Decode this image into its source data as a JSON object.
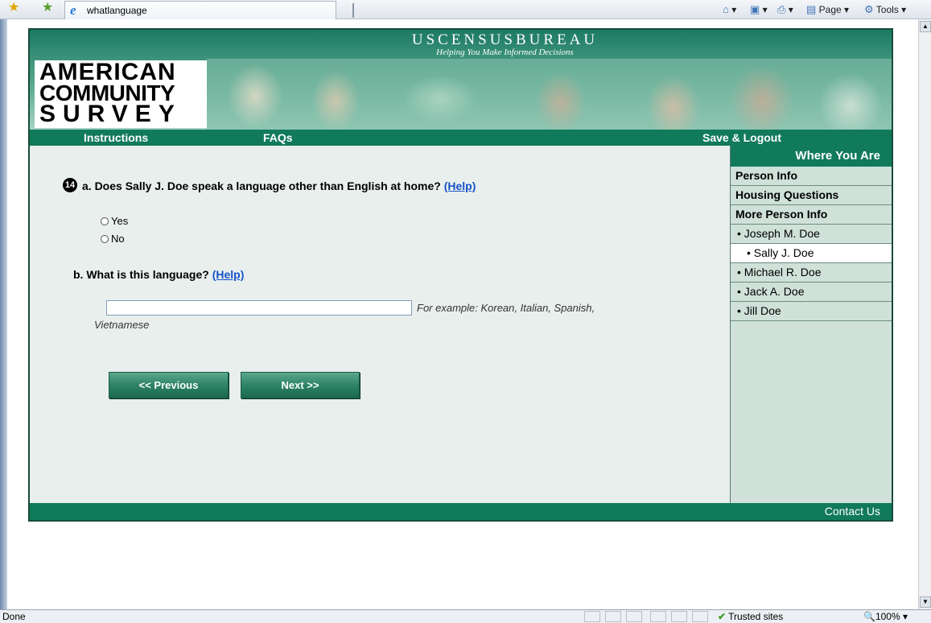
{
  "browser": {
    "tab_title": "whatlanguage",
    "toolbar": {
      "page_label": "Page",
      "tools_label": "Tools"
    },
    "status": {
      "text": "Done",
      "zone": "Trusted sites",
      "zoom": "100%"
    }
  },
  "header": {
    "agency_title": "USCENSUSBUREAU",
    "agency_tagline": "Helping You Make Informed Decisions",
    "logo_lines": [
      "AMERICAN",
      "COMMUNITY",
      "SURVEY"
    ]
  },
  "nav": {
    "instructions": "Instructions",
    "faqs": "FAQs",
    "save_logout": "Save & Logout"
  },
  "question": {
    "number": "14",
    "a_text": "a. Does Sally J. Doe speak a language other than English at home?",
    "b_text": "b. What is this language?",
    "help_label": "(Help)",
    "options": [
      "Yes",
      "No"
    ],
    "language_value": "",
    "hint_line1": "For example: Korean, Italian, Spanish,",
    "hint_line2": "Vietnamese"
  },
  "buttons": {
    "previous": "<<   Previous",
    "next": "Next   >>"
  },
  "sidebar": {
    "title": "Where You Are",
    "sections": [
      "Person Info",
      "Housing Questions",
      "More Person Info"
    ],
    "people": [
      "• Joseph M. Doe",
      "• Sally J. Doe",
      "• Michael R. Doe",
      "• Jack A. Doe",
      "• Jill Doe"
    ],
    "current_person": "• Sally J. Doe"
  },
  "footer": {
    "contact": "Contact Us"
  },
  "colors": {
    "brand_green": "#117a5a",
    "panel_bg": "#e8efed",
    "sidebar_bg": "#cfe1d9",
    "link_blue": "#1752c8"
  }
}
